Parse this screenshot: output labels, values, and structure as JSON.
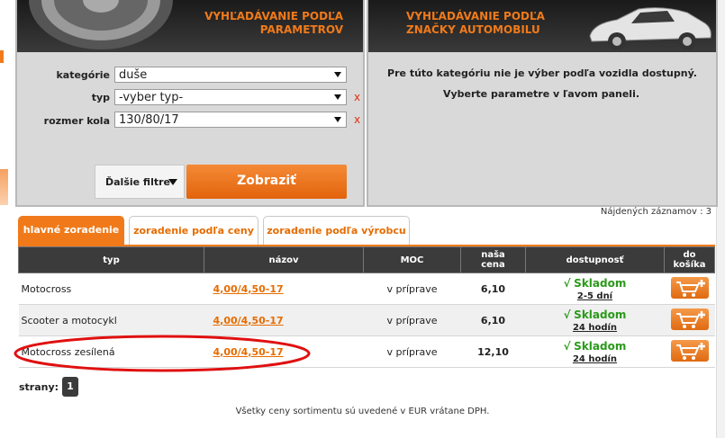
{
  "left_panel": {
    "title_line1": "VYHĽADÁVANIE PODĽA",
    "title_line2": "PARAMETROV",
    "fields": [
      {
        "label": "kategórie",
        "value": "duše",
        "clear": ""
      },
      {
        "label": "typ",
        "value": "-vyber typ-",
        "clear": "x"
      },
      {
        "label": "rozmer kola",
        "value": "130/80/17",
        "clear": "x"
      }
    ],
    "more_filters": "Ďalšie filtre",
    "show_button": "Zobraziť"
  },
  "right_panel": {
    "title_line1": "VYHĽADÁVANIE PODĽA",
    "title_line2": "ZNAČKY AUTOMOBILU",
    "message_line1": "Pre túto kategóriu nie je výber podľa vozidla dostupný.",
    "message_line2": "Vyberte parametre v ľavom paneli."
  },
  "found_records": "Nájdených záznamov : 3",
  "tabs": [
    {
      "label": "hlavné zoradenie"
    },
    {
      "label": "zoradenie podľa ceny"
    },
    {
      "label": "zoradenie podľa výrobcu"
    }
  ],
  "table": {
    "headers": {
      "typ": "typ",
      "nazov": "názov",
      "moc": "MOC",
      "cena_1": "naša",
      "cena_2": "cena",
      "dostupnost": "dostupnosť",
      "kosik_1": "do",
      "kosik_2": "košíka"
    },
    "rows": [
      {
        "typ": "Motocross",
        "nazov": "4,00/4,50-17",
        "moc": "v príprave",
        "cena": "6,10",
        "stock": "Skladom",
        "time": "2-5 dní"
      },
      {
        "typ": "Scooter a motocykl",
        "nazov": "4,00/4,50-17",
        "moc": "v príprave",
        "cena": "6,10",
        "stock": "Skladom",
        "time": "24 hodín"
      },
      {
        "typ": "Motocross zesílená",
        "nazov": "4,00/4,50-17",
        "moc": "v príprave",
        "cena": "12,10",
        "stock": "Skladom",
        "time": "24 hodín"
      }
    ]
  },
  "pagination": {
    "label": "strany:",
    "page": "1"
  },
  "footer_note": "Všetky ceny sortimentu sú uvedené v EUR vrátane DPH.",
  "colors": {
    "accent": "#f07a1a",
    "stock": "#2a9a1a",
    "highlight": "#e01010"
  },
  "icons": {
    "checkmark": "√",
    "cart": "cart-plus-icon",
    "dropdown": "triangle-down-icon"
  }
}
